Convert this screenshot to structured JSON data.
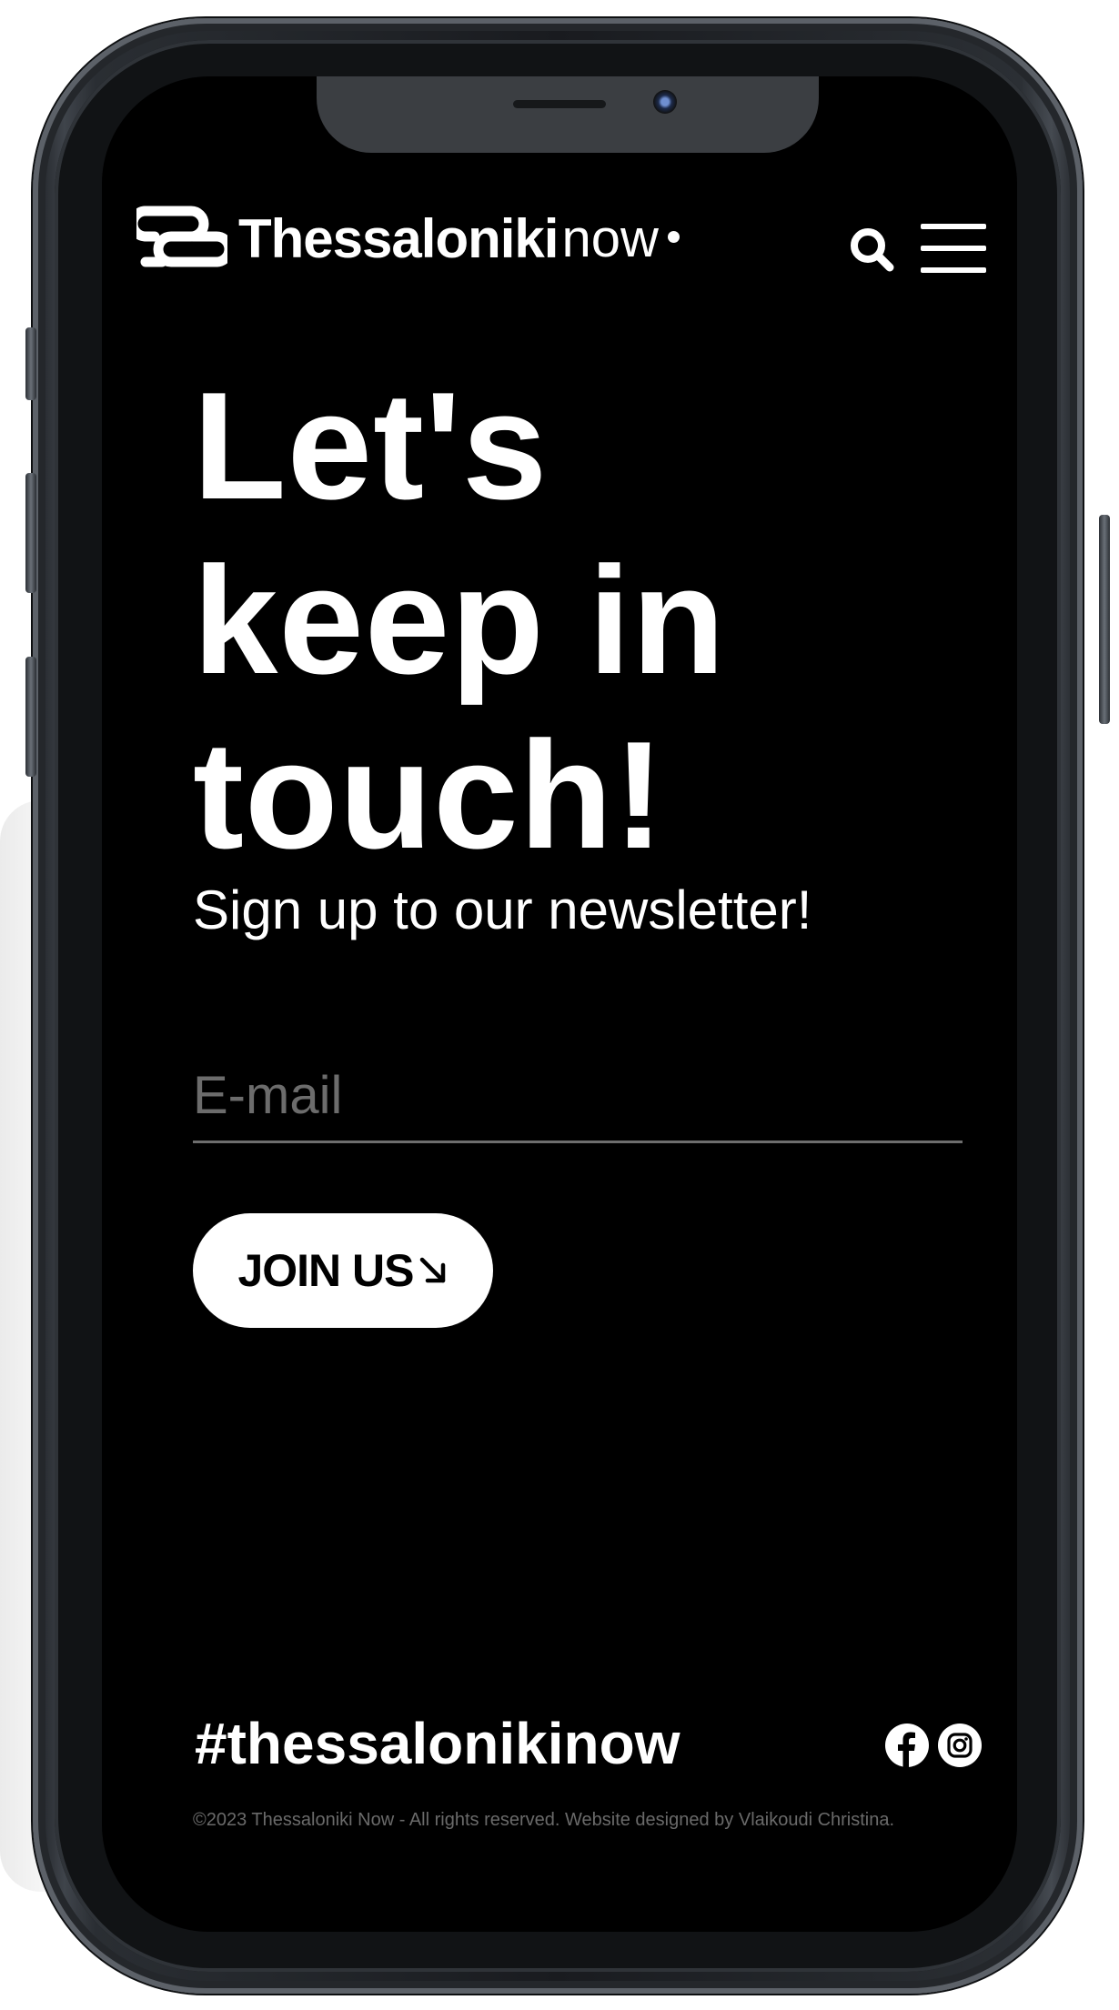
{
  "brand": {
    "name_bold": "Thessaloniki",
    "name_light": "now"
  },
  "icons": {
    "logo": "logo-mark-icon",
    "search": "search-icon",
    "menu": "hamburger-menu-icon",
    "join_arrow": "arrow-down-right-icon",
    "facebook": "facebook-icon",
    "instagram": "instagram-icon"
  },
  "hero": {
    "title_lines": [
      "Let's",
      "keep in",
      "touch!"
    ],
    "subtitle": "Sign up to our newsletter!"
  },
  "form": {
    "email_placeholder": "E-mail",
    "email_value": "",
    "join_label": "JOIN US"
  },
  "footer": {
    "hashtag": "#thessalonikinow",
    "copyright": "©2023 Thessaloniki Now - All rights reserved.  Website designed by Vlaikoudi Christina."
  },
  "colors": {
    "background": "#000000",
    "text": "#ffffff",
    "muted": "#6a6a6a",
    "button_bg": "#ffffff",
    "button_text": "#000000"
  }
}
